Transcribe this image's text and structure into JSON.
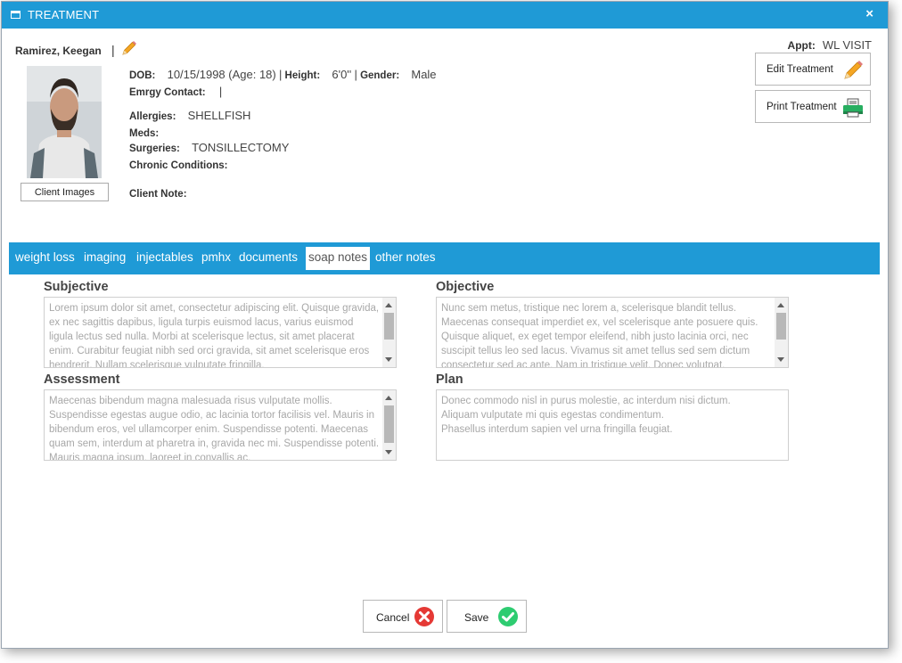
{
  "window": {
    "title": "TREATMENT",
    "close_label": "×"
  },
  "client": {
    "name": "Ramirez, Keegan",
    "separator": "|",
    "client_images_label": "Client Images",
    "dob_label": "DOB:",
    "dob_value": "10/15/1998 (Age: 18)",
    "height_label": "Height:",
    "height_value": "6'0''",
    "gender_label": "Gender:",
    "gender_value": "Male",
    "emergency_label": "Emrgy Contact:",
    "emergency_value": "|",
    "allergies_label": "Allergies:",
    "allergies_value": "SHELLFISH",
    "meds_label": "Meds:",
    "meds_value": "",
    "surgeries_label": "Surgeries:",
    "surgeries_value": "TONSILLECTOMY",
    "chronic_label": "Chronic Conditions:",
    "chronic_value": "",
    "note_label": "Client Note:",
    "note_value": ""
  },
  "appointment": {
    "label": "Appt:",
    "value": "WL VISIT"
  },
  "actions": {
    "edit_label": "Edit Treatment",
    "print_label": "Print Treatment"
  },
  "tabs": [
    {
      "label": "weight loss",
      "active": false
    },
    {
      "label": "imaging",
      "active": false
    },
    {
      "label": "injectables",
      "active": false
    },
    {
      "label": "pmhx",
      "active": false
    },
    {
      "label": "documents",
      "active": false
    },
    {
      "label": "soap notes",
      "active": true
    },
    {
      "label": "other notes",
      "active": false
    }
  ],
  "soap": {
    "subjective": {
      "title": "Subjective",
      "text": "Lorem ipsum dolor sit amet, consectetur adipiscing elit. Quisque gravida, ex nec sagittis dapibus, ligula turpis euismod lacus, varius euismod ligula lectus sed nulla. Morbi at scelerisque lectus, sit amet placerat enim. Curabitur feugiat nibh sed orci gravida, sit amet scelerisque eros hendrerit. Nullam scelerisque vulputate fringilla."
    },
    "objective": {
      "title": "Objective",
      "text": "Nunc sem metus, tristique nec lorem a, scelerisque blandit tellus. Maecenas consequat imperdiet ex, vel scelerisque ante posuere quis. Quisque aliquet, ex eget tempor eleifend, nibh justo lacinia orci, nec suscipit tellus leo sed lacus. Vivamus sit amet tellus sed sem dictum consectetur sed ac ante. Nam in tristique velit. Donec volutpat."
    },
    "assessment": {
      "title": "Assessment",
      "text": "Maecenas bibendum magna malesuada risus vulputate mollis. Suspendisse egestas augue odio, ac lacinia tortor facilisis vel. Mauris in bibendum eros, vel ullamcorper enim. Suspendisse potenti. Maecenas quam sem, interdum at pharetra in, gravida nec mi. Suspendisse potenti. Mauris magna ipsum, laoreet in convallis ac."
    },
    "plan": {
      "title": "Plan",
      "lines": [
        "Donec commodo nisl in purus molestie, ac interdum nisi dictum.",
        "Aliquam vulputate mi quis egestas condimentum.",
        "Phasellus interdum sapien vel urna fringilla feugiat."
      ]
    }
  },
  "footer": {
    "cancel_label": "Cancel",
    "save_label": "Save"
  },
  "colors": {
    "accent": "#1f9ad6",
    "cancel": "#e53935",
    "save": "#2ecc71",
    "pencil": "#f5a623",
    "printer": "#27ae60"
  }
}
